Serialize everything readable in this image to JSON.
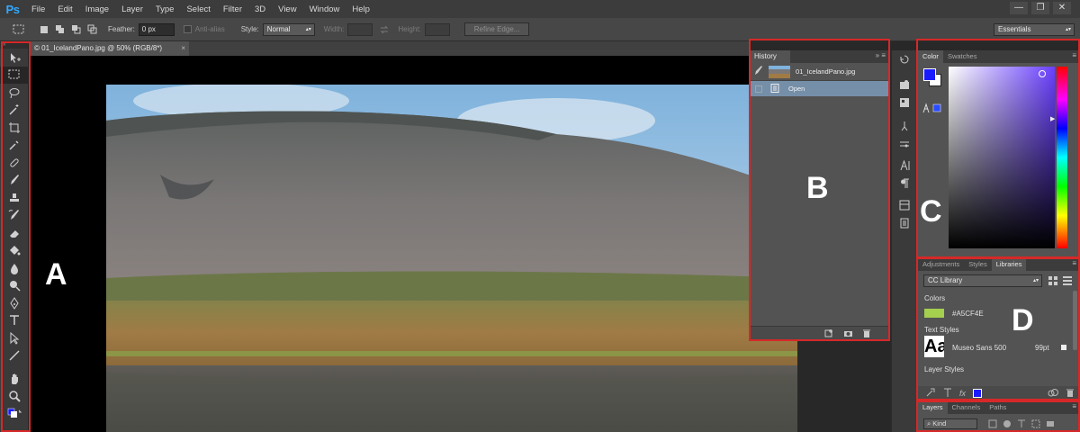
{
  "app": {
    "logo": "Ps"
  },
  "menu": [
    "File",
    "Edit",
    "Image",
    "Layer",
    "Type",
    "Select",
    "Filter",
    "3D",
    "View",
    "Window",
    "Help"
  ],
  "window_controls": [
    "—",
    "❐",
    "✕"
  ],
  "options": {
    "feather_label": "Feather:",
    "feather_value": "0 px",
    "antialias_label": "Anti-alias",
    "style_label": "Style:",
    "style_value": "Normal",
    "width_label": "Width:",
    "height_label": "Height:",
    "refine_edge": "Refine Edge...",
    "workspace": "Essentials"
  },
  "document": {
    "tab_title": "© 01_IcelandPano.jpg @ 50% (RGB/8*)",
    "close": "×"
  },
  "history": {
    "tab": "History",
    "snapshot": "01_IcelandPano.jpg",
    "rows": [
      "Open"
    ]
  },
  "color_panel": {
    "tabs": [
      "Color",
      "Swatches"
    ],
    "fg_color": "#1a1aff",
    "bg_color": "#ffffff"
  },
  "libraries_panel": {
    "tabs": [
      "Adjustments",
      "Styles",
      "Libraries"
    ],
    "library": "CC Library",
    "colors_heading": "Colors",
    "color_value": "#A5CF4E",
    "text_styles_heading": "Text Styles",
    "text_style_name": "Museo Sans 500",
    "text_style_size": "99pt",
    "layer_styles_heading": "Layer Styles"
  },
  "layers_panel": {
    "tabs": [
      "Layers",
      "Channels",
      "Paths"
    ],
    "kind": "Kind"
  },
  "annotations": {
    "a": "A",
    "b": "B",
    "c": "C",
    "d": "D"
  },
  "accent_colors": {
    "highlight_box": "#d62828",
    "history_selected": "#758fa9"
  }
}
